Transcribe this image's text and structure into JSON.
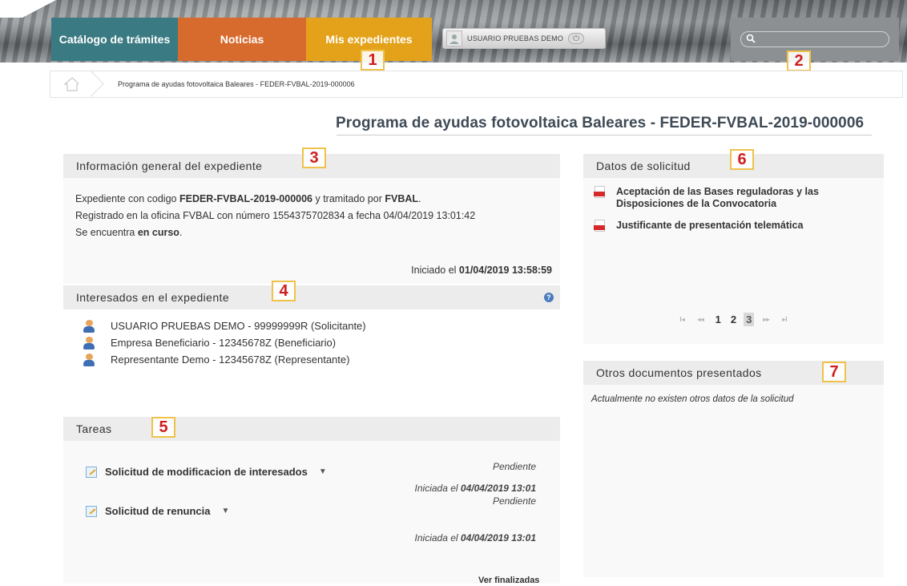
{
  "header": {
    "tabs": [
      {
        "label": "Catálogo de trámites"
      },
      {
        "label": "Noticias"
      },
      {
        "label": "Mis expedientes"
      }
    ],
    "user_label": "USUARIO PRUEBAS DEMO",
    "search_placeholder": ""
  },
  "markers": [
    "1",
    "2",
    "3",
    "4",
    "5",
    "6",
    "7"
  ],
  "breadcrumb": {
    "current": "Programa de ayudas fotovoltaica Baleares - FEDER-FVBAL-2019-000006"
  },
  "page_title": "Programa de ayudas fotovoltaica Baleares - FEDER-FVBAL-2019-000006",
  "info": {
    "title": "Información general del expediente",
    "line1_pre": "Expediente con codigo ",
    "line1_code": "FEDER-FVBAL-2019-000006",
    "line1_mid": " y tramitado por ",
    "line1_org": "FVBAL",
    "line1_end": ".",
    "line2": "Registrado en la oficina FVBAL con número 1554375702834 a fecha 04/04/2019 13:01:42",
    "line3_pre": "Se encuentra ",
    "line3_state": "en curso",
    "line3_end": ".",
    "started_pre": "Iniciado el ",
    "started_date": "01/04/2019 13:58:59"
  },
  "interesados": {
    "title": "Interesados en el expediente",
    "people": [
      "USUARIO PRUEBAS DEMO - 99999999R (Solicitante)",
      "Empresa Beneficiario - 12345678Z (Beneficiario)",
      "Representante Demo - 12345678Z (Representante)"
    ]
  },
  "tareas": {
    "title": "Tareas",
    "items": [
      {
        "name": "Solicitud de modificacion de interesados",
        "status": "Pendiente",
        "started_pre": "Iniciada el ",
        "started_date": "04/04/2019 13:01"
      },
      {
        "name": "Solicitud de renuncia",
        "status": "Pendiente",
        "started_pre": "Iniciada el ",
        "started_date": "04/04/2019 13:01"
      }
    ],
    "ver_finalizadas": "Ver finalizadas"
  },
  "datos": {
    "title": "Datos de solicitud",
    "docs": [
      "Aceptación de las Bases reguladoras y las Disposiciones de la Convocatoria",
      "Justificante de presentación telemática"
    ],
    "pager": {
      "first": "I◂",
      "prev": "◂◂",
      "pages": [
        "1",
        "2",
        "3"
      ],
      "active_page": "3",
      "next": "▸▸",
      "last": "▸I"
    }
  },
  "otros": {
    "title": "Otros documentos presentados",
    "empty_text": "Actualmente no existen otros datos de la solicitud"
  },
  "colors": {
    "tab_catalogo": "#3a7a82",
    "tab_noticias": "#d76a2d",
    "tab_expedientes": "#e4a21a",
    "marker_text": "#d01e1e",
    "marker_border": "#f0c24b"
  },
  "icons": [
    "user-avatar-icon",
    "power-icon",
    "search-icon",
    "home-icon",
    "help-icon",
    "person-icon",
    "task-edit-icon",
    "caret-down-icon",
    "pdf-icon"
  ]
}
